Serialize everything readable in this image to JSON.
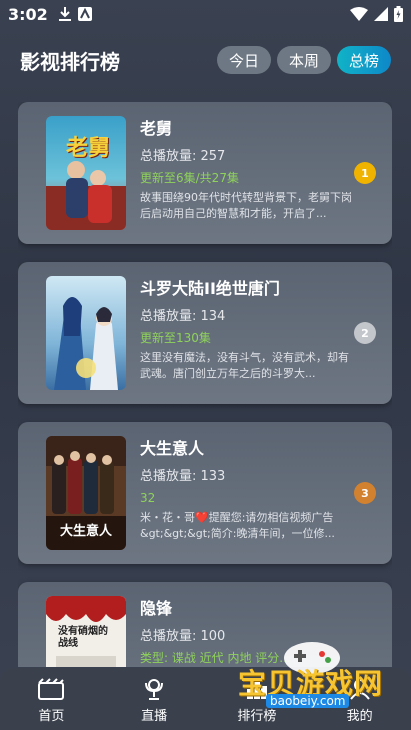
{
  "status_bar": {
    "time": "3:02"
  },
  "header": {
    "title": "影视排行榜",
    "tabs": [
      {
        "label": "今日",
        "active": false
      },
      {
        "label": "本周",
        "active": false
      },
      {
        "label": "总榜",
        "active": true
      }
    ]
  },
  "list": [
    {
      "title": "老舅",
      "plays": "总播放量: 257",
      "update": "更新至6集/共27集",
      "desc": "故事围绕90年代时代转型背景下，老舅下岗后启动用自己的智慧和才能，开启了...",
      "rank": "1",
      "rank_color": "#f0b400",
      "poster_caption": "老舅"
    },
    {
      "title": "斗罗大陆II绝世唐门",
      "plays": "总播放量: 134",
      "update": "更新至130集",
      "desc": "这里没有魔法，没有斗气，没有武术，却有武魂。唐门创立万年之后的斗罗大...",
      "rank": "2",
      "rank_color": "#c3c7cc",
      "poster_caption": ""
    },
    {
      "title": "大生意人",
      "plays": "总播放量: 133",
      "update": "32",
      "desc": "米・花・哥❤️提醒您:请勿相信视频广告&gt;&gt;&gt;简介:晚清年间，一位修...",
      "rank": "3",
      "rank_color": "#d2822f",
      "poster_caption": "大生意人"
    },
    {
      "title": "隐锋",
      "plays": "总播放量: 100",
      "update": "类型: 谍战 近代 内地 评分...",
      "desc": "",
      "rank": "",
      "rank_color": "",
      "poster_caption": "没有硝烟的战线"
    }
  ],
  "bottom_nav": [
    {
      "label": "首页",
      "icon": "film-icon"
    },
    {
      "label": "直播",
      "icon": "live-icon"
    },
    {
      "label": "排行榜",
      "icon": "rank-icon"
    },
    {
      "label": "我的",
      "icon": "profile-icon"
    }
  ],
  "watermark": {
    "text": "宝贝游戏网",
    "url": "baobeiy.com"
  },
  "colors": {
    "accent": "#0e9cc8",
    "update_green": "#8fd25b"
  }
}
